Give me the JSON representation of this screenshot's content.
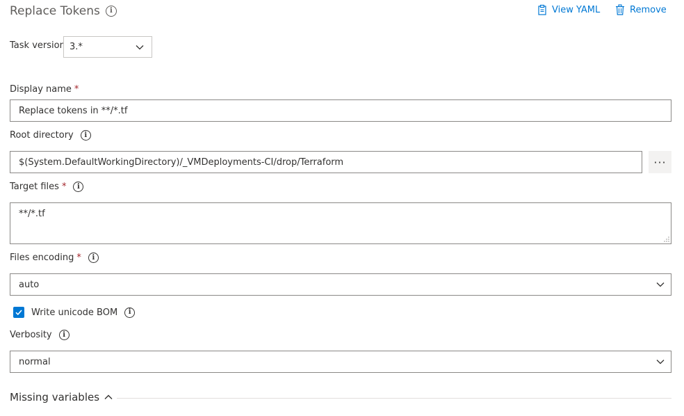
{
  "header": {
    "title": "Replace Tokens",
    "view_yaml": "View YAML",
    "remove": "Remove"
  },
  "task_version": {
    "label": "Task version",
    "value": "3.*"
  },
  "display_name": {
    "label": "Display name",
    "required": "*",
    "value": "Replace tokens in **/*.tf"
  },
  "root_directory": {
    "label": "Root directory",
    "value": "$(System.DefaultWorkingDirectory)/_VMDeployments-CI/drop/Terraform",
    "browse": "···"
  },
  "target_files": {
    "label": "Target files",
    "required": "*",
    "value": "**/*.tf"
  },
  "files_encoding": {
    "label": "Files encoding",
    "required": "*",
    "value": "auto"
  },
  "write_bom": {
    "label": "Write unicode BOM",
    "checked": true
  },
  "verbosity": {
    "label": "Verbosity",
    "value": "normal"
  },
  "missing_variables": {
    "label": "Missing variables"
  },
  "icons": {
    "info": "info-icon",
    "view_yaml": "clipboard-icon",
    "remove": "trash-icon",
    "dropdown": "chevron-down-icon",
    "collapse": "chevron-up-icon",
    "check": "checkmark-icon"
  },
  "colors": {
    "accent": "#0078d4",
    "required": "#a4262c",
    "border": "#8a8886",
    "text": "#323130"
  }
}
